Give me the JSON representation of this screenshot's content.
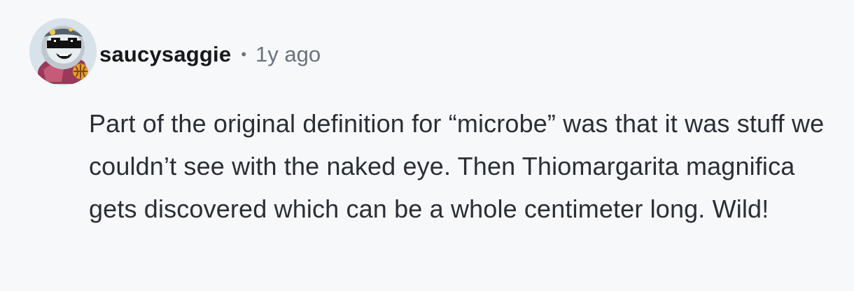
{
  "comment": {
    "author": "saucysaggie",
    "separator": "•",
    "timestamp": "1y ago",
    "body": "Part of the original definition for “microbe” was that it was stuff we couldn’t see with the naked eye. Then Thiomargarita magnifica gets discovered which can be a whole centimeter long. Wild!"
  },
  "avatar": {
    "icon": "snoo-avatar-with-pixel-sunglasses"
  },
  "colors": {
    "background": "#f7f8fa",
    "username": "#16181b",
    "muted": "#6b727c",
    "body": "#2b2f34"
  }
}
